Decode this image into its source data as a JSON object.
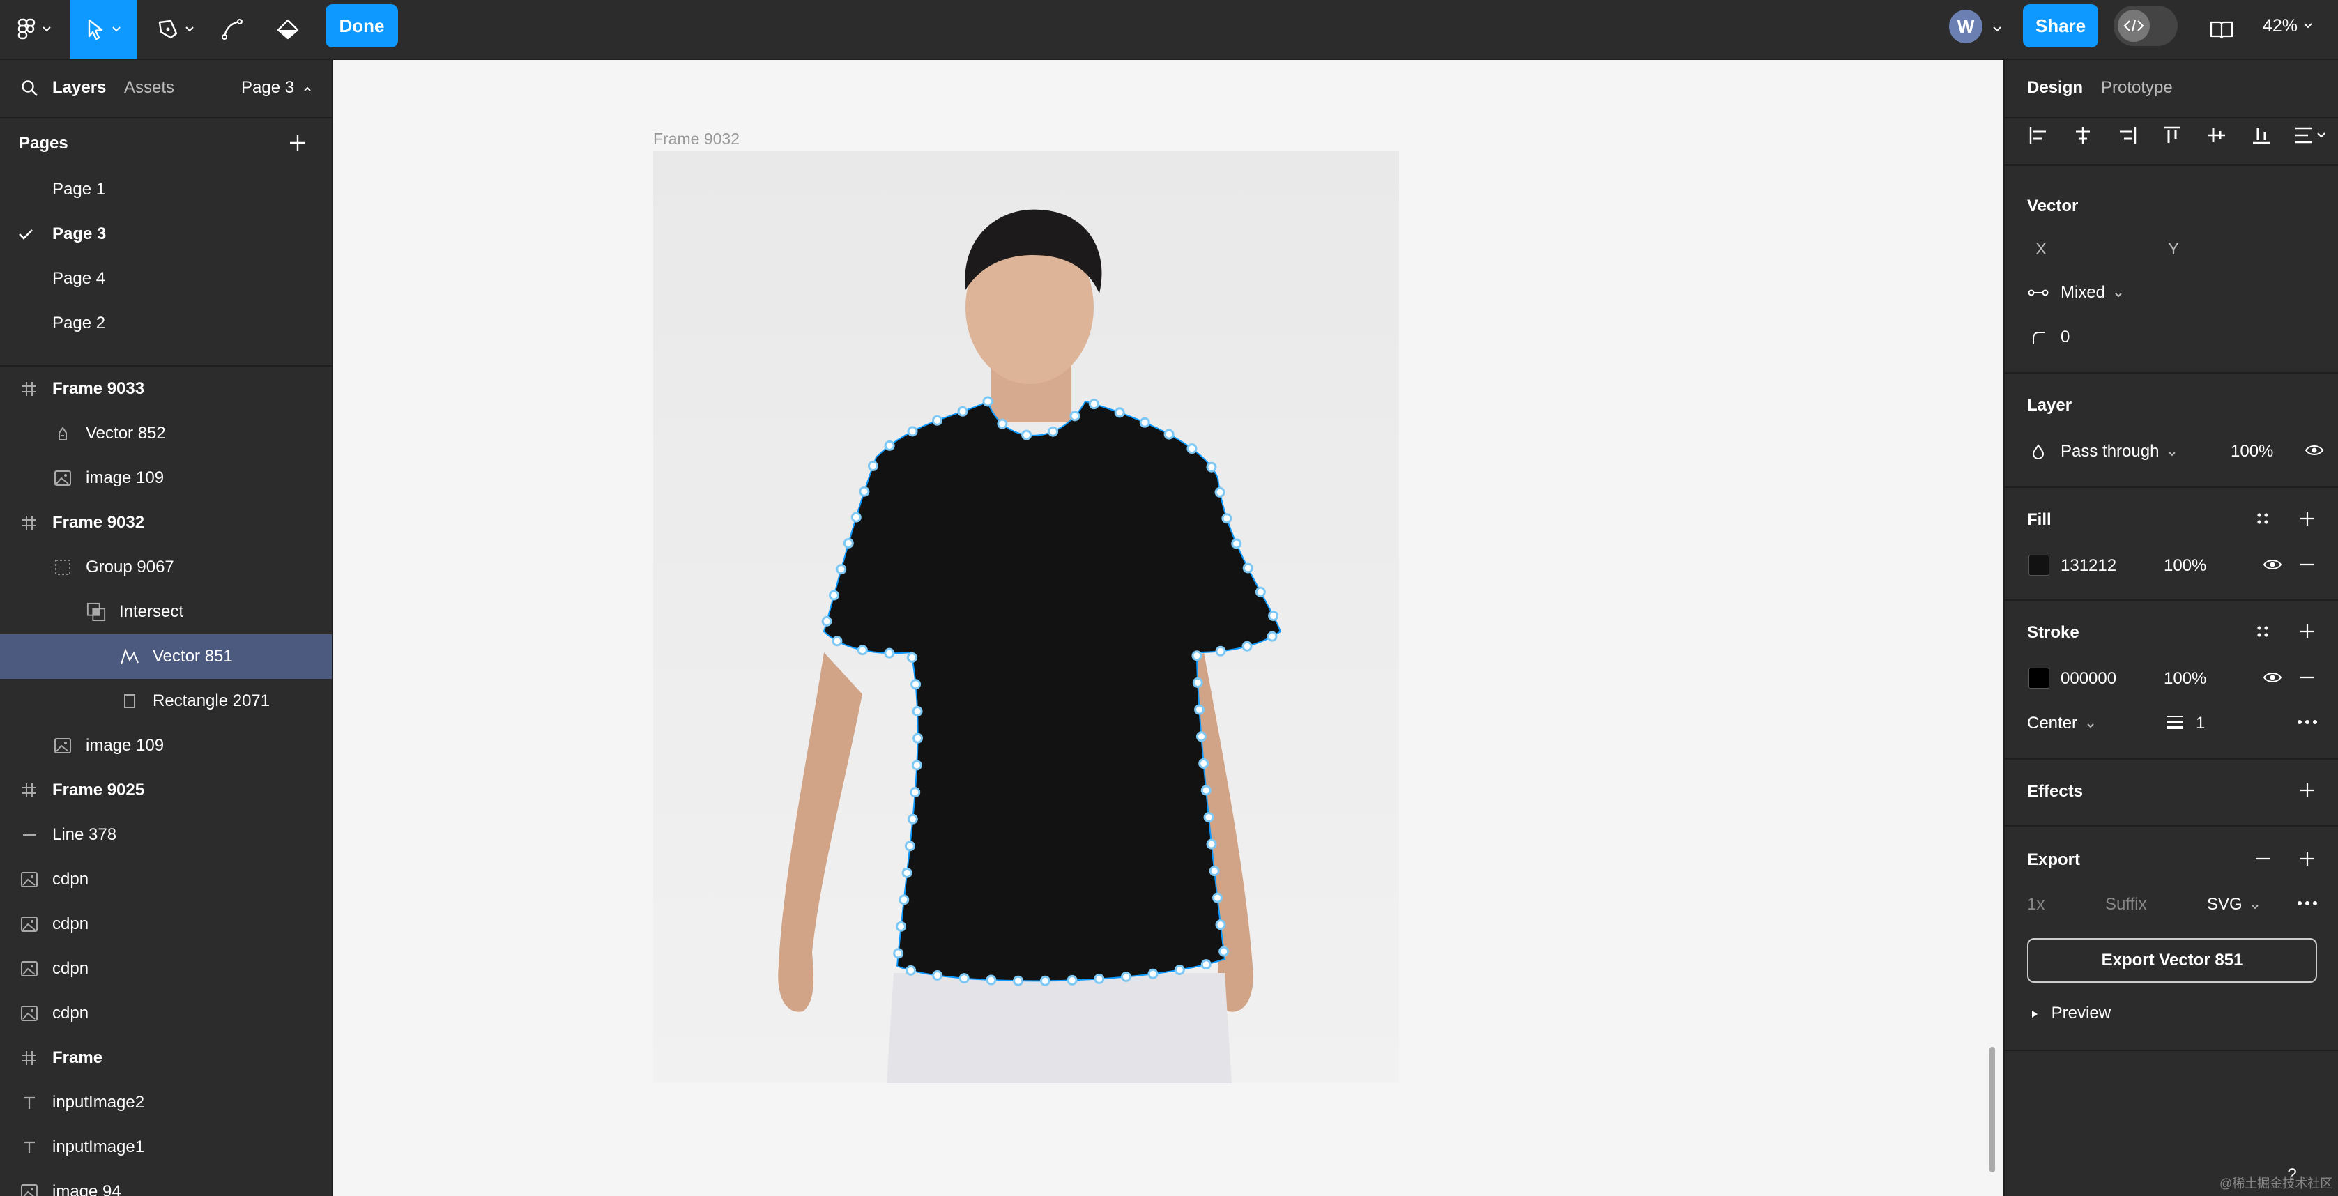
{
  "toolbar": {
    "done_label": "Done",
    "share_label": "Share",
    "avatar_letter": "W",
    "zoom": "42%"
  },
  "left_panel": {
    "tabs": {
      "layers": "Layers",
      "assets": "Assets",
      "page": "Page 3"
    },
    "pages_title": "Pages",
    "pages": [
      "Page 1",
      "Page 3",
      "Page 4",
      "Page 2"
    ],
    "selected_page": "Page 3",
    "layers": [
      {
        "name": "Frame 9033",
        "icon": "frame-icon"
      },
      {
        "name": "Vector 852",
        "icon": "vector-icon"
      },
      {
        "name": "image 109",
        "icon": "image-icon"
      },
      {
        "name": "Frame 9032",
        "icon": "frame-icon"
      },
      {
        "name": "Group 9067",
        "icon": "group-icon"
      },
      {
        "name": "Intersect",
        "icon": "intersect-icon"
      },
      {
        "name": "Vector 851",
        "icon": "pen-vector-icon"
      },
      {
        "name": "Rectangle 2071",
        "icon": "rectangle-icon"
      },
      {
        "name": "image 109",
        "icon": "image-icon"
      },
      {
        "name": "Frame 9025",
        "icon": "frame-icon"
      },
      {
        "name": "Line 378",
        "icon": "line-icon"
      },
      {
        "name": "cdpn",
        "icon": "image-icon"
      },
      {
        "name": "cdpn",
        "icon": "image-icon"
      },
      {
        "name": "cdpn",
        "icon": "image-icon"
      },
      {
        "name": "cdpn",
        "icon": "image-icon"
      },
      {
        "name": "Frame",
        "icon": "frame-icon"
      },
      {
        "name": "inputImage2",
        "icon": "text-icon"
      },
      {
        "name": "inputImage1",
        "icon": "text-icon"
      },
      {
        "name": "image 94",
        "icon": "image-icon"
      }
    ]
  },
  "canvas": {
    "frame_label": "Frame 9032",
    "watermark": "@稀土掘金技术社区"
  },
  "right_panel": {
    "tabs": {
      "design": "Design",
      "prototype": "Prototype"
    },
    "vector": {
      "title": "Vector",
      "x_label": "X",
      "y_label": "Y",
      "constraint": "Mixed",
      "radius": "0"
    },
    "layer": {
      "title": "Layer",
      "blend": "Pass through",
      "opacity": "100%"
    },
    "fill": {
      "title": "Fill",
      "hex": "131212",
      "opacity": "100%",
      "color": "#131212"
    },
    "stroke": {
      "title": "Stroke",
      "hex": "000000",
      "opacity": "100%",
      "color": "#000000",
      "position": "Center",
      "weight": "1"
    },
    "effects": {
      "title": "Effects"
    },
    "export": {
      "title": "Export",
      "scale": "1x",
      "suffix": "Suffix",
      "format": "SVG",
      "button": "Export Vector 851",
      "preview": "Preview"
    }
  },
  "help_label": "?",
  "colors": {
    "accent": "#0d99ff",
    "selection": "#4c5a80",
    "panel": "#2c2c2c",
    "vector_point": "#7ec8f5"
  }
}
